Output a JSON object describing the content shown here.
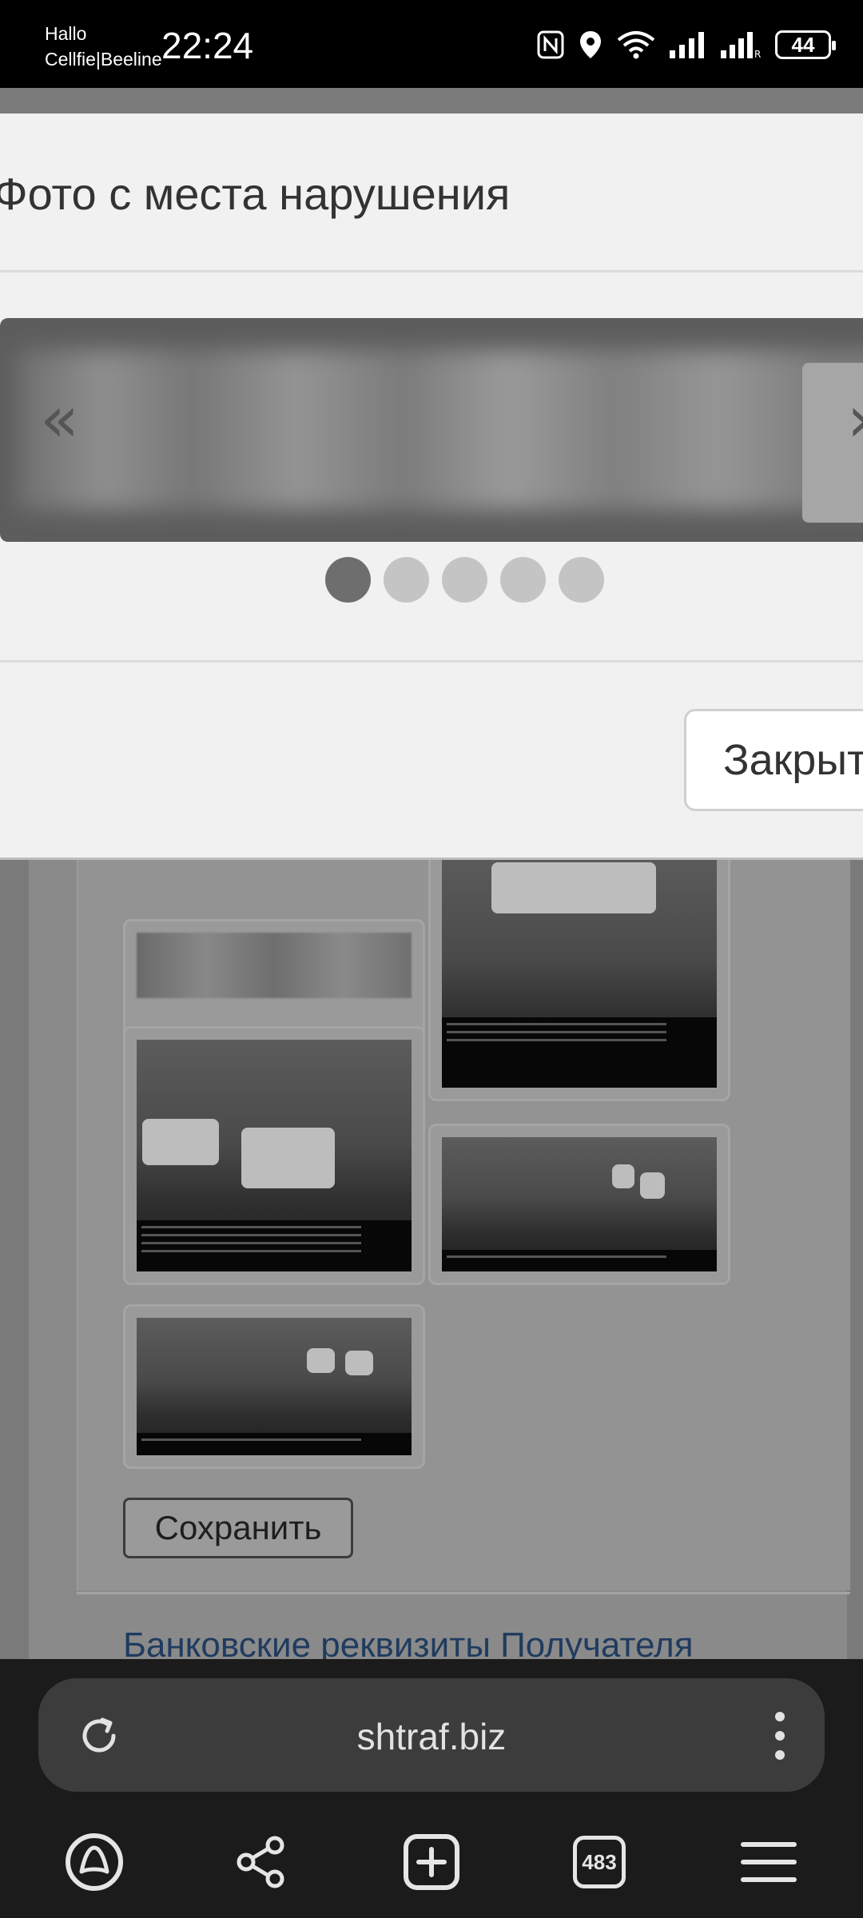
{
  "status_bar": {
    "carrier_line1": "Hallo",
    "carrier_line2": "Cellfie|Beeline",
    "time": "22:24",
    "battery": "44",
    "icons": [
      "nfc-icon",
      "location-icon",
      "wifi-icon",
      "signal-icon",
      "signal-roaming-icon",
      "battery-icon"
    ]
  },
  "modal": {
    "title": "Фото с места нарушения",
    "prev_label": "«",
    "next_label": "»",
    "slide_count": 5,
    "active_slide": 1,
    "close_label": "Закрыть"
  },
  "page": {
    "save_label": "Сохранить",
    "bank_link": "Банковские реквизиты Получателя"
  },
  "browser": {
    "url": "shtraf.biz",
    "tabs_count": "483",
    "nav_icons": [
      "alice-icon",
      "share-icon",
      "new-tab-icon",
      "tabs-icon",
      "menu-icon"
    ]
  },
  "colors": {
    "modal_bg": "#f1f1f1",
    "overlay": "#7a7a7a",
    "link": "#1f3b5f",
    "browser_bg": "#1b1b1b"
  }
}
